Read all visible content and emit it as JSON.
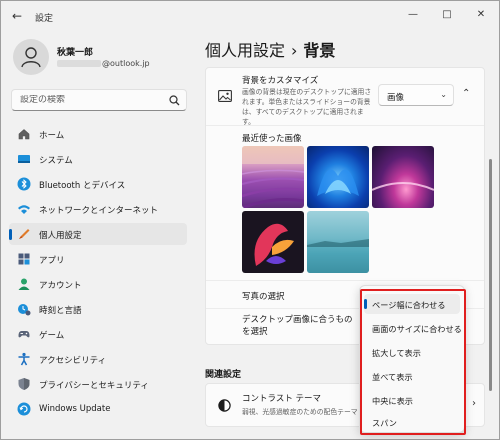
{
  "window": {
    "title": "設定",
    "back_icon": "back-arrow-icon",
    "controls": [
      "minimize-icon",
      "maximize-icon",
      "close-icon"
    ]
  },
  "profile": {
    "name": "秋葉一郎",
    "email_visible": "@outlook.jp"
  },
  "search": {
    "placeholder": "設定の検索"
  },
  "sidebar": {
    "items": [
      {
        "label": "ホーム",
        "icon": "home-icon",
        "active": false
      },
      {
        "label": "システム",
        "icon": "system-icon",
        "active": false
      },
      {
        "label": "Bluetooth とデバイス",
        "icon": "bluetooth-icon",
        "active": false
      },
      {
        "label": "ネットワークとインターネット",
        "icon": "network-icon",
        "active": false
      },
      {
        "label": "個人用設定",
        "icon": "personalization-icon",
        "active": true
      },
      {
        "label": "アプリ",
        "icon": "apps-icon",
        "active": false
      },
      {
        "label": "アカウント",
        "icon": "account-icon",
        "active": false
      },
      {
        "label": "時刻と言語",
        "icon": "time-language-icon",
        "active": false
      },
      {
        "label": "ゲーム",
        "icon": "gaming-icon",
        "active": false
      },
      {
        "label": "アクセシビリティ",
        "icon": "accessibility-icon",
        "active": false
      },
      {
        "label": "プライバシーとセキュリティ",
        "icon": "privacy-shield-icon",
        "active": false
      },
      {
        "label": "Windows Update",
        "icon": "windows-update-icon",
        "active": false
      }
    ]
  },
  "breadcrumb": {
    "parent": "個人用設定",
    "separator": "›",
    "current": "背景"
  },
  "background": {
    "title": "背景をカスタマイズ",
    "description": "画像の背景は現在のデスクトップに適用されます。単色またはスライドショーの背景は、すべてのデスクトップに適用されます。",
    "select_value": "画像",
    "recent_title": "最近使った画像",
    "choose_photo_label": "写真の選択",
    "fit_label": "デスクトップ画像に合うものを選択"
  },
  "related": {
    "title": "関連設定",
    "contrast_title": "コントラスト テーマ",
    "contrast_desc": "弱視、光感過敏症のための配色テーマ"
  },
  "fit_menu": {
    "items": [
      {
        "label": "ページ幅に合わせる",
        "selected": true
      },
      {
        "label": "画面のサイズに合わせる",
        "selected": false
      },
      {
        "label": "拡大して表示",
        "selected": false
      },
      {
        "label": "並べて表示",
        "selected": false
      },
      {
        "label": "中央に表示",
        "selected": false
      },
      {
        "label": "スパン",
        "selected": false
      }
    ]
  },
  "colors": {
    "accent": "#005fb8",
    "highlight": "#e01e1e"
  }
}
